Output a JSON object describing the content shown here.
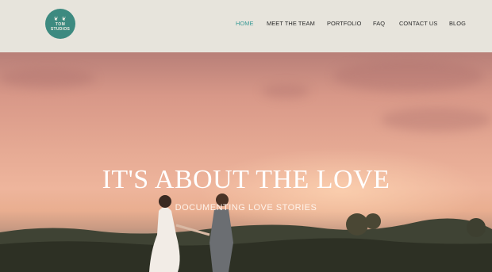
{
  "logo": {
    "leaf_top": "❦ ❦",
    "line1": "TOM",
    "line2": "STUDIOS"
  },
  "nav": {
    "items": [
      {
        "label": "HOME",
        "active": true
      },
      {
        "label": "MEET THE TEAM",
        "active": false
      },
      {
        "label": "PORTFOLIO",
        "active": false
      },
      {
        "label": "FAQ",
        "active": false
      },
      {
        "label": "CONTACT US",
        "active": false
      },
      {
        "label": "BLOG",
        "active": false
      }
    ]
  },
  "hero": {
    "headline": "IT'S ABOUT THE LOVE",
    "subline": "DOCUMENTING LOVE STORIES"
  },
  "colors": {
    "header_bg": "#e7e4dc",
    "accent": "#3b9a96",
    "logo_bg": "#3d8a80"
  }
}
